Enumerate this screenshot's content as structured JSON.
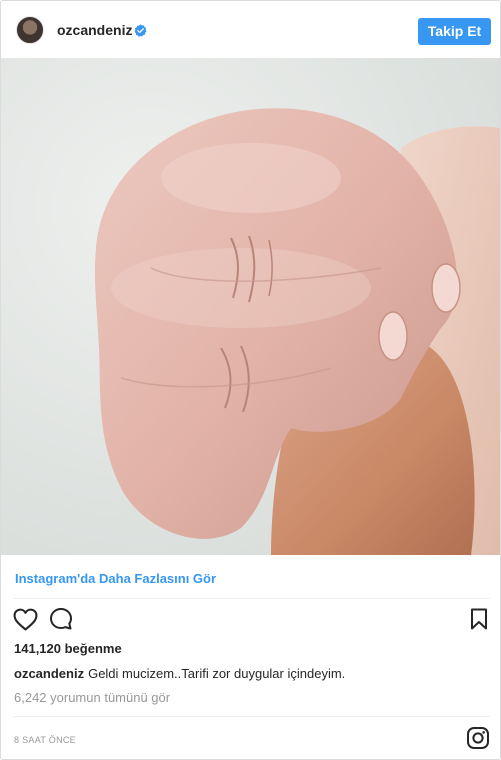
{
  "header": {
    "username": "ozcandeniz",
    "follow_label": "Takip Et"
  },
  "post": {
    "more_link": "Instagram'da Daha Fazlasını Gör",
    "likes": "141,120 beğenme",
    "caption_user": "ozcandeniz",
    "caption_text": "Geldi mucizem..Tarifi zor duygular içindeyim.",
    "view_comments": "6,242 yorumun tümünü gör",
    "timestamp": "8 SAAT ÖNCE"
  },
  "colors": {
    "accent": "#3897f0",
    "text": "#262626",
    "muted": "#999999"
  },
  "icons": [
    "verified-badge-icon",
    "heart-icon",
    "comment-icon",
    "bookmark-icon",
    "instagram-logo-icon"
  ]
}
